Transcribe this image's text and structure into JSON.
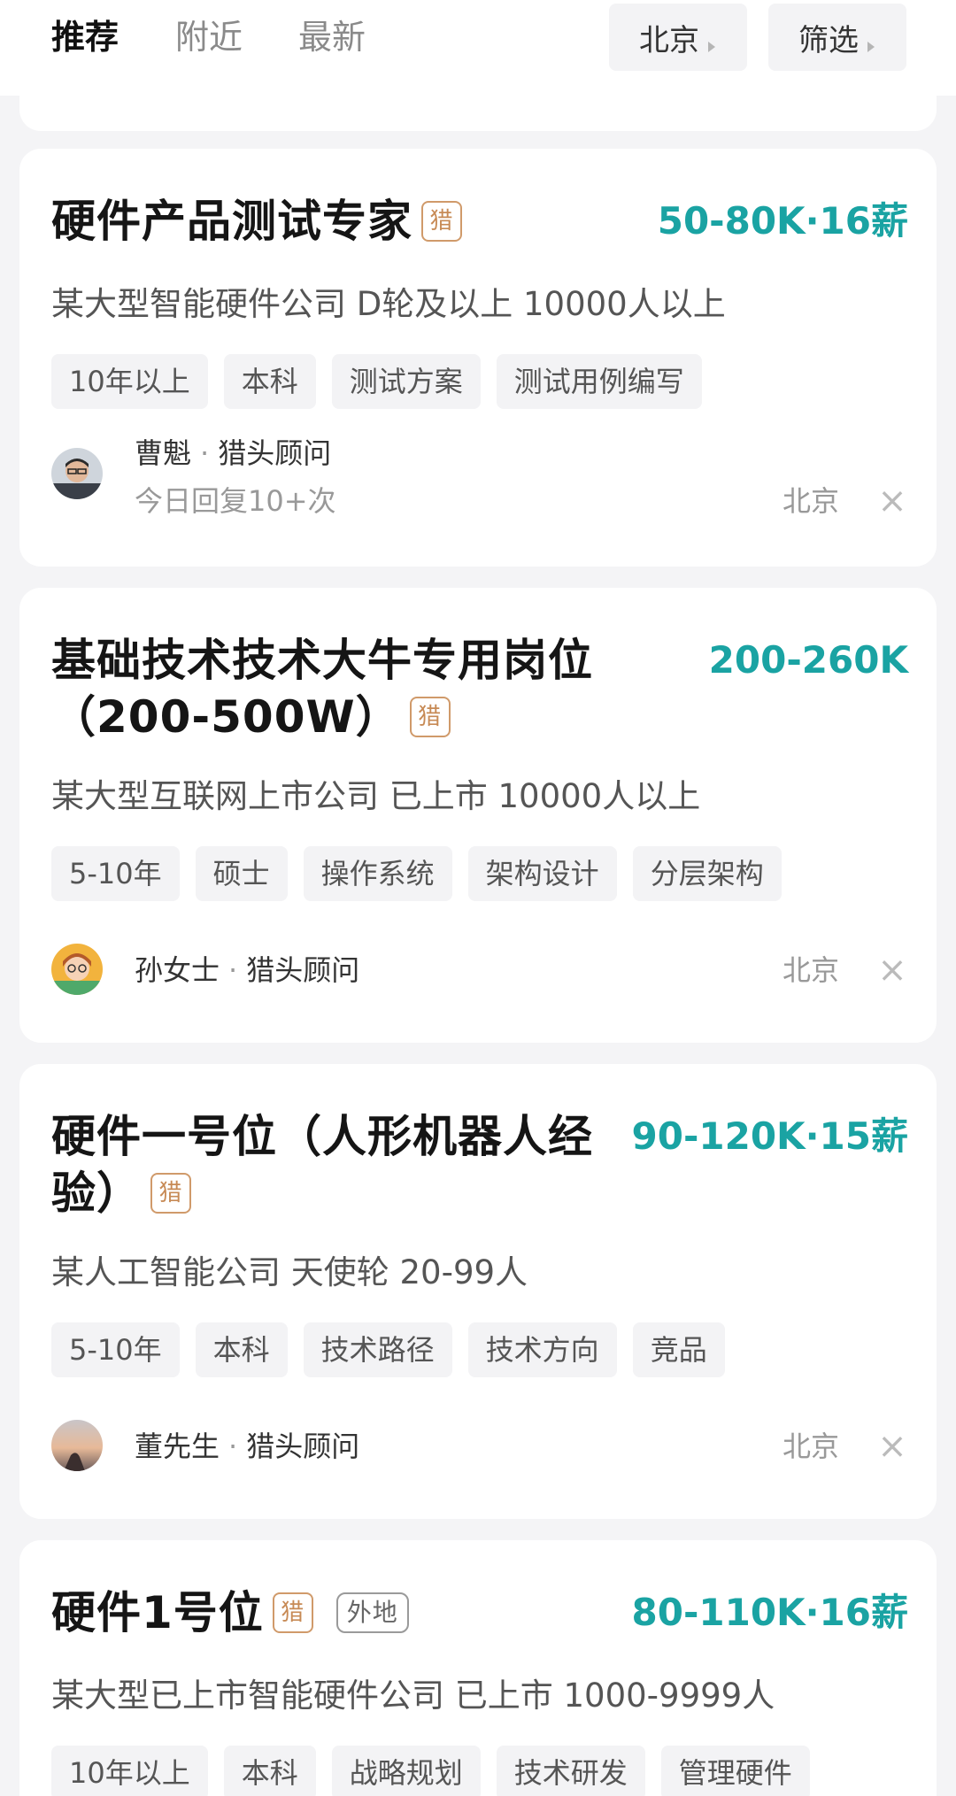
{
  "tabs": [
    "推荐",
    "附近",
    "最新"
  ],
  "city_label": "北京",
  "filter_label": "筛选",
  "jobs": [
    {
      "title": "硬件产品测试专家",
      "badge": "猎",
      "salary": "50-80K·16薪",
      "company": "某大型智能硬件公司  D轮及以上  10000人以上",
      "tags": [
        "10年以上",
        "本科",
        "测试方案",
        "测试用例编写"
      ],
      "recruiter": "曹魁",
      "role": "猎头顾问",
      "reply": "今日回复10+次",
      "location": "北京",
      "close": "×"
    },
    {
      "title_line1": "基础技术技术大牛专用岗位",
      "title_line2": "（200-500W）",
      "badge": "猎",
      "salary": "200-260K",
      "company": "某大型互联网上市公司  已上市  10000人以上",
      "tags": [
        "5-10年",
        "硕士",
        "操作系统",
        "架构设计",
        "分层架构"
      ],
      "recruiter": "孙女士",
      "role": "猎头顾问",
      "location": "北京",
      "close": "×"
    },
    {
      "title_line1": "硬件一号位（人形机器人经",
      "title_line2": "验）",
      "badge": "猎",
      "salary": "90-120K·15薪",
      "company": "某人工智能公司  天使轮  20-99人",
      "tags": [
        "5-10年",
        "本科",
        "技术路径",
        "技术方向",
        "竞品"
      ],
      "recruiter": "董先生",
      "role": "猎头顾问",
      "location": "北京",
      "close": "×"
    },
    {
      "title": "硬件1号位",
      "badge": "猎",
      "remote_badge": "外地",
      "salary": "80-110K·16薪",
      "company": "某大型已上市智能硬件公司  已上市  1000-9999人",
      "tags": [
        "10年以上",
        "本科",
        "战略规划",
        "技术研发",
        "管理硬件"
      ]
    }
  ]
}
